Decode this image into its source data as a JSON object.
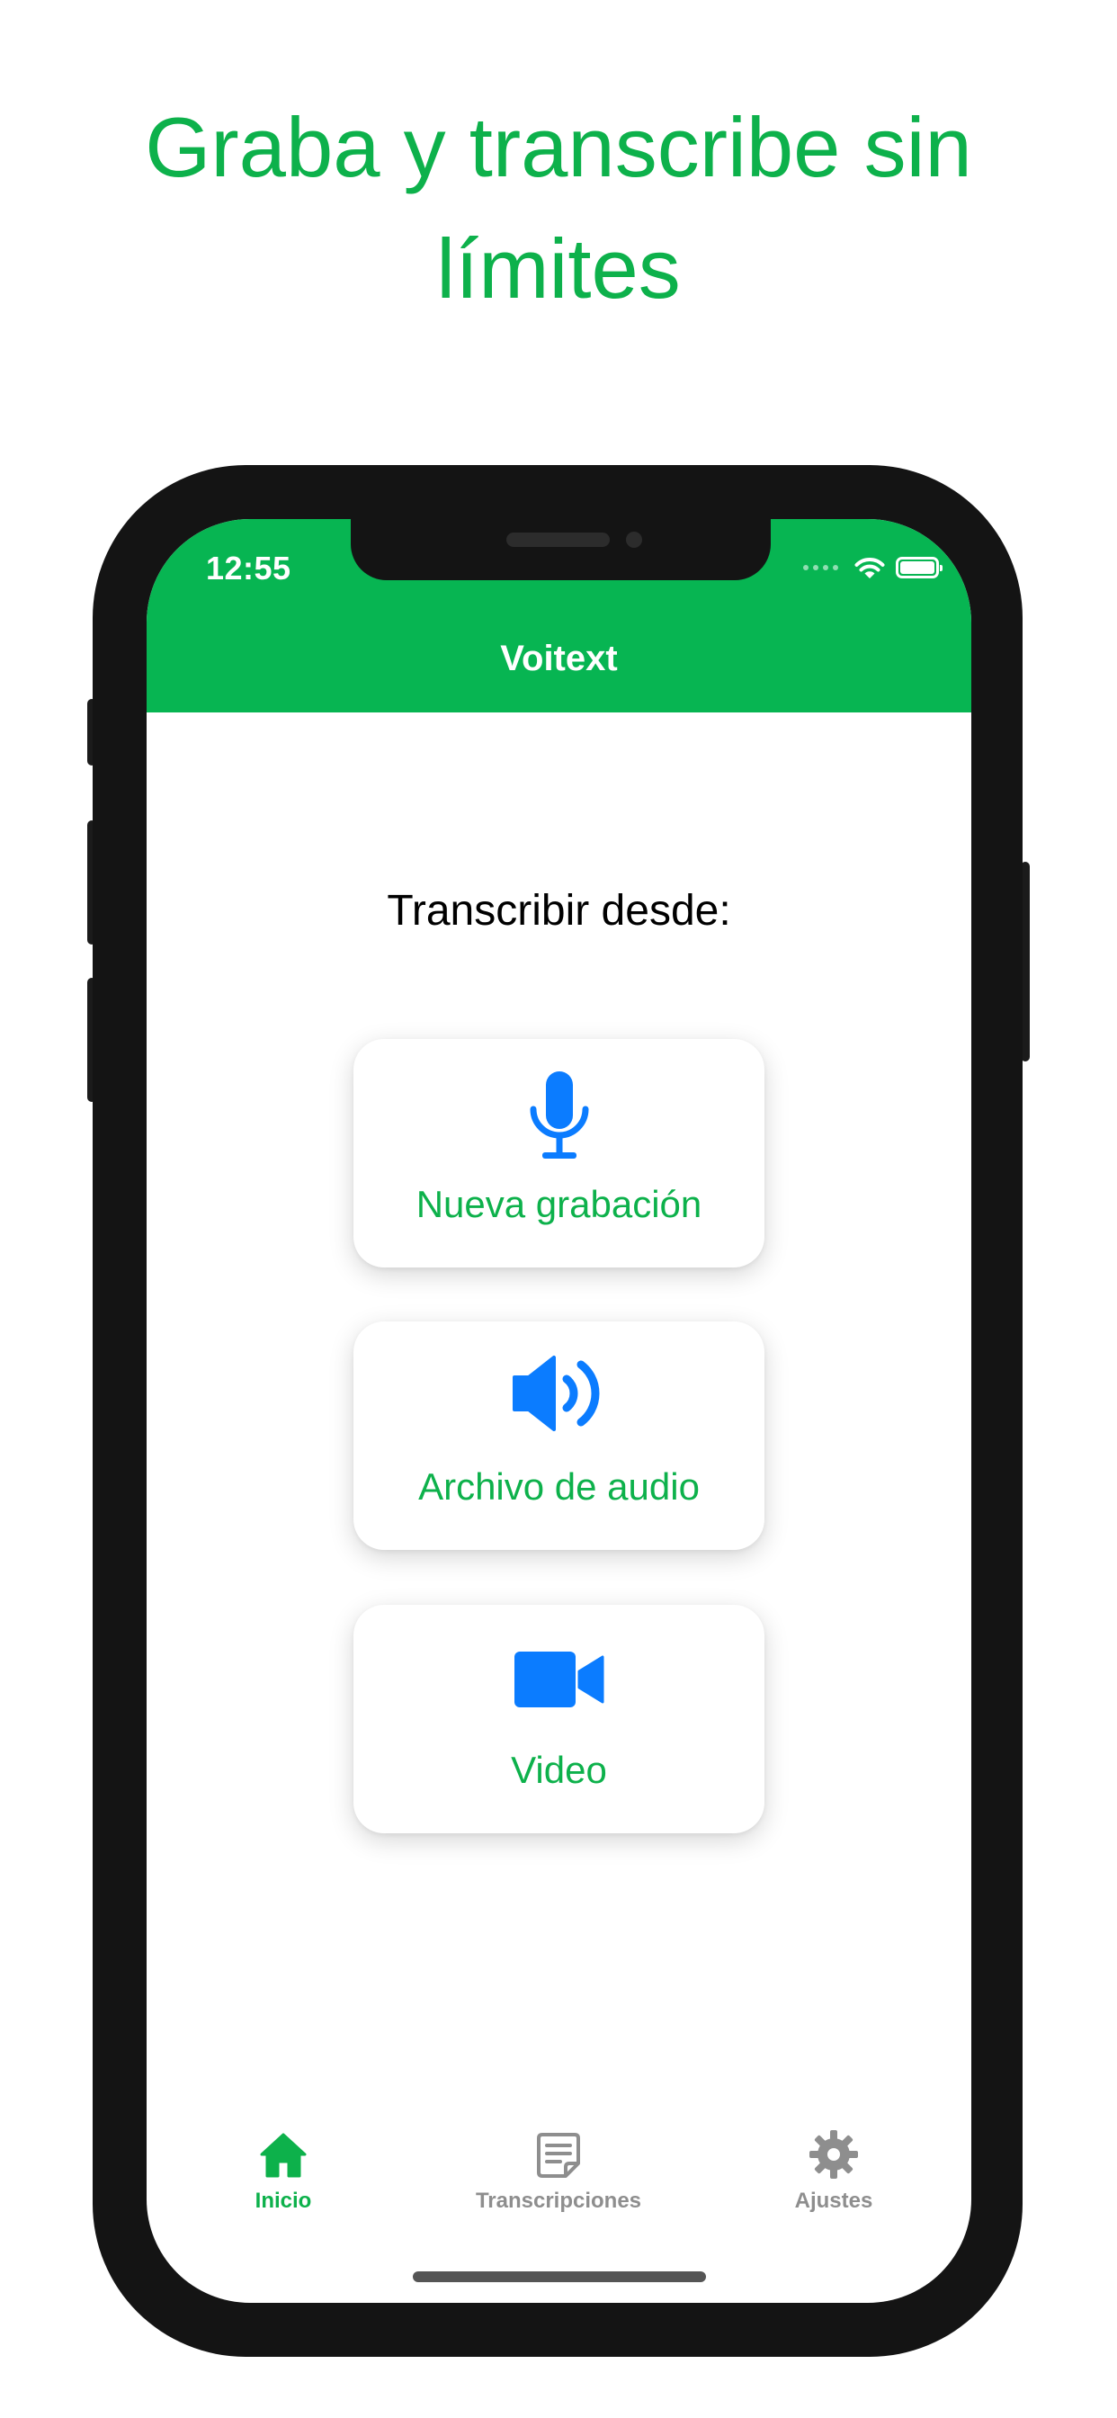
{
  "headline": "Graba y transcribe sin límites",
  "status_bar": {
    "time": "12:55"
  },
  "nav": {
    "title": "Voitext"
  },
  "main": {
    "subtitle": "Transcribir desde:",
    "options": [
      {
        "label": "Nueva grabación",
        "icon": "microphone-icon"
      },
      {
        "label": "Archivo de audio",
        "icon": "speaker-icon"
      },
      {
        "label": "Video",
        "icon": "video-camera-icon"
      }
    ]
  },
  "tabbar": {
    "tabs": [
      {
        "label": "Inicio",
        "icon": "house-icon",
        "active": true
      },
      {
        "label": "Transcripciones",
        "icon": "document-icon",
        "active": false
      },
      {
        "label": "Ajustes",
        "icon": "gear-icon",
        "active": false
      }
    ]
  },
  "colors": {
    "brand_green": "#07b552",
    "text_green": "#0db14b",
    "icon_blue": "#0b7cff",
    "inactive_gray": "#8e8e8e",
    "phone_frame": "#141414"
  }
}
